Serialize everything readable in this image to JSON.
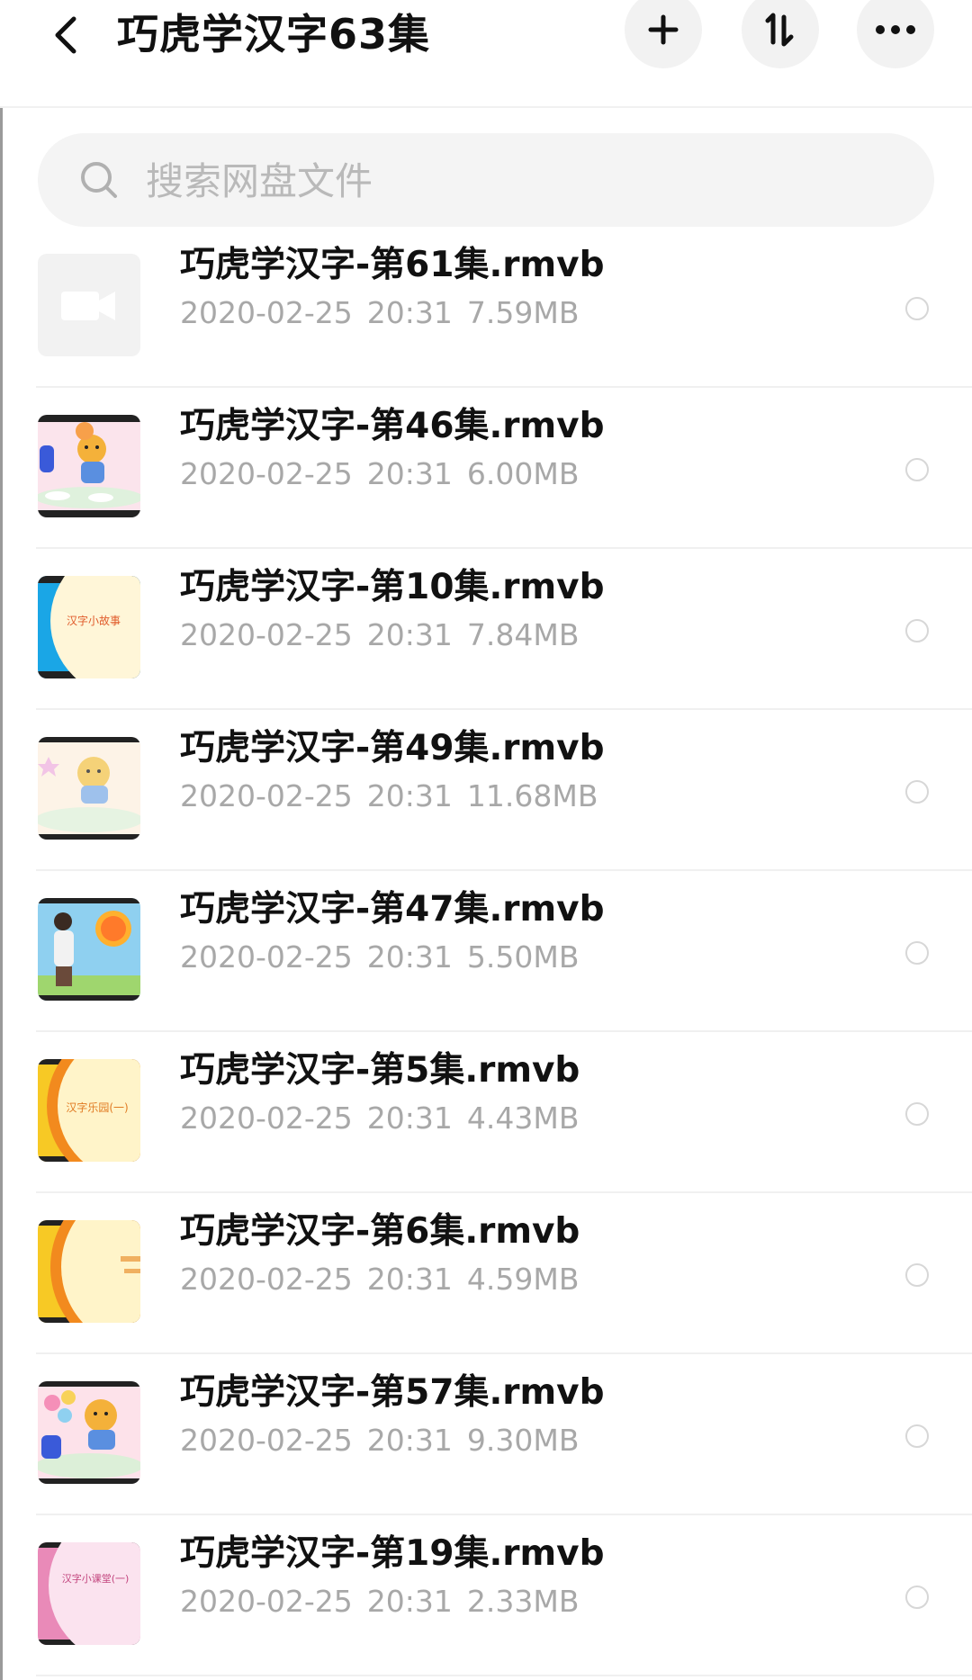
{
  "header": {
    "title": "巧虎学汉字63集",
    "icons": {
      "back": "chevron-left-icon",
      "add": "plus-icon",
      "sort": "sort-icon",
      "more": "more-horizontal-icon"
    }
  },
  "search": {
    "placeholder": "搜索网盘文件",
    "icon": "search-icon"
  },
  "files": [
    {
      "name": "巧虎学汉字-第61集.rmvb",
      "date": "2020-02-25",
      "time": "20:31",
      "size": "7.59MB",
      "thumb": "video-placeholder"
    },
    {
      "name": "巧虎学汉字-第46集.rmvb",
      "date": "2020-02-25",
      "time": "20:31",
      "size": "6.00MB",
      "thumb": "tiger-pink"
    },
    {
      "name": "巧虎学汉字-第10集.rmvb",
      "date": "2020-02-25",
      "time": "20:31",
      "size": "7.84MB",
      "thumb": "blue-arc",
      "thumb_text": "汉字小故事"
    },
    {
      "name": "巧虎学汉字-第49集.rmvb",
      "date": "2020-02-25",
      "time": "20:31",
      "size": "11.68MB",
      "thumb": "tiger-light"
    },
    {
      "name": "巧虎学汉字-第47集.rmvb",
      "date": "2020-02-25",
      "time": "20:31",
      "size": "5.50MB",
      "thumb": "woman-sun"
    },
    {
      "name": "巧虎学汉字-第5集.rmvb",
      "date": "2020-02-25",
      "time": "20:31",
      "size": "4.43MB",
      "thumb": "orange-arc",
      "thumb_text": "汉字乐园(一)"
    },
    {
      "name": "巧虎学汉字-第6集.rmvb",
      "date": "2020-02-25",
      "time": "20:31",
      "size": "4.59MB",
      "thumb": "orange-arc-2"
    },
    {
      "name": "巧虎学汉字-第57集.rmvb",
      "date": "2020-02-25",
      "time": "20:31",
      "size": "9.30MB",
      "thumb": "tiger-balloons"
    },
    {
      "name": "巧虎学汉字-第19集.rmvb",
      "date": "2020-02-25",
      "time": "20:31",
      "size": "2.33MB",
      "thumb": "pink-arc",
      "thumb_text": "汉字小课堂(一)"
    }
  ],
  "colors": {
    "accent_bg": "#f2f2f2",
    "meta_text": "#a8a8a8",
    "divider": "#f0f0f0"
  }
}
